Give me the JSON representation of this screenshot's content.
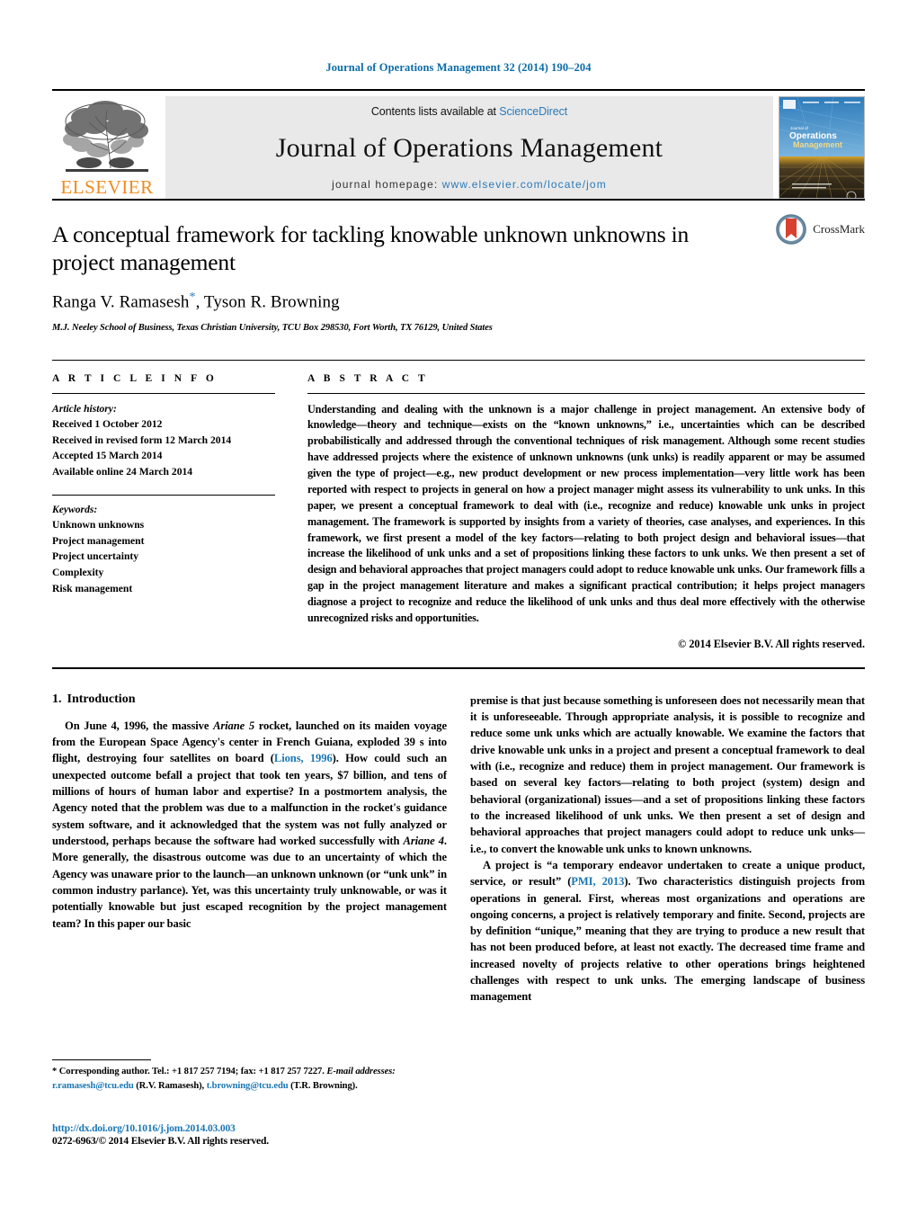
{
  "running_head": "Journal of Operations Management 32 (2014) 190–204",
  "masthead": {
    "contents_prefix": "Contents lists available at ",
    "sciencedirect": "ScienceDirect",
    "journal_name": "Journal of Operations Management",
    "homepage_label": "journal homepage:",
    "homepage_url": "www.elsevier.com/locate/jom",
    "publisher": "ELSEVIER",
    "cover_line1": "Journal of",
    "cover_line2": "Operations",
    "cover_line3": "Management",
    "link_color": "#2a7ab9",
    "publisher_color": "#ee8b1e"
  },
  "article": {
    "title": "A conceptual framework for tackling knowable unknown unknowns in project management",
    "authors": "Ranga V. Ramasesh",
    "authors_rest": ", Tyson R. Browning",
    "corresponding_marker": "*",
    "affiliation": "M.J. Neeley School of Business, Texas Christian University, TCU Box 298530, Fort Worth, TX 76129, United States",
    "crossmark_label": "CrossMark"
  },
  "info": {
    "heading": "A R T I C L E   I N F O",
    "history_label": "Article history:",
    "history": [
      "Received 1 October 2012",
      "Received in revised form 12 March 2014",
      "Accepted 15 March 2014",
      "Available online 24 March 2014"
    ],
    "keywords_label": "Keywords:",
    "keywords": [
      "Unknown unknowns",
      "Project management",
      "Project uncertainty",
      "Complexity",
      "Risk management"
    ]
  },
  "abstract": {
    "heading": "A B S T R A C T",
    "text": "Understanding and dealing with the unknown is a major challenge in project management. An extensive body of knowledge—theory and technique—exists on the “known unknowns,” i.e., uncertainties which can be described probabilistically and addressed through the conventional techniques of risk management. Although some recent studies have addressed projects where the existence of unknown unknowns (unk unks) is readily apparent or may be assumed given the type of project—e.g., new product development or new process implementation—very little work has been reported with respect to projects in general on how a project manager might assess its vulnerability to unk unks. In this paper, we present a conceptual framework to deal with (i.e., recognize and reduce) knowable unk unks in project management. The framework is supported by insights from a variety of theories, case analyses, and experiences. In this framework, we first present a model of the key factors—relating to both project design and behavioral issues—that increase the likelihood of unk unks and a set of propositions linking these factors to unk unks. We then present a set of design and behavioral approaches that project managers could adopt to reduce knowable unk unks. Our framework fills a gap in the project management literature and makes a significant practical contribution; it helps project managers diagnose a project to recognize and reduce the likelihood of unk unks and thus deal more effectively with the otherwise unrecognized risks and opportunities.",
    "copyright": "© 2014 Elsevier B.V. All rights reserved."
  },
  "body": {
    "section_number": "1.",
    "section_title": "Introduction",
    "left_p1_a": "On June 4, 1996, the massive ",
    "left_p1_italic1": "Ariane 5",
    "left_p1_b": " rocket, launched on its maiden voyage from the European Space Agency's center in French Guiana, exploded 39 s into flight, destroying four satellites on board (",
    "left_p1_cite": "Lions, 1996",
    "left_p1_c": "). How could such an unexpected outcome befall a project that took ten years, $7 billion, and tens of millions of hours of human labor and expertise? In a postmortem analysis, the Agency noted that the problem was due to a malfunction in the rocket's guidance system software, and it acknowledged that the system was not fully analyzed or understood, perhaps because the software had worked successfully with ",
    "left_p1_italic2": "Ariane 4",
    "left_p1_d": ". More generally, the disastrous outcome was due to an uncertainty of which the Agency was unaware prior to the launch—an unknown unknown (or “unk unk” in common industry parlance). Yet, was this uncertainty truly unknowable, or was it potentially knowable but just escaped recognition by the project management team? In this paper our basic",
    "right_p1": "premise is that just because something is unforeseen does not necessarily mean that it is unforeseeable. Through appropriate analysis, it is possible to recognize and reduce some unk unks which are actually knowable. We examine the factors that drive knowable unk unks in a project and present a conceptual framework to deal with (i.e., recognize and reduce) them in project management. Our framework is based on several key factors—relating to both project (system) design and behavioral (organizational) issues—and a set of propositions linking these factors to the increased likelihood of unk unks. We then present a set of design and behavioral approaches that project managers could adopt to reduce unk unks—i.e., to convert the knowable unk unks to known unknowns.",
    "right_p2_a": "A project is “a temporary endeavor undertaken to create a unique product, service, or result” (",
    "right_p2_cite": "PMI, 2013",
    "right_p2_b": "). Two characteristics distinguish projects from operations in general. First, whereas most organizations and operations are ongoing concerns, a project is relatively temporary and finite. Second, projects are by definition “unique,” meaning that they are trying to produce a new result that has not been produced before, at least not exactly. The decreased time frame and increased novelty of projects relative to other operations brings heightened challenges with respect to unk unks. The emerging landscape of business management"
  },
  "footnote": {
    "corresponding": "* Corresponding author. Tel.: +1 817 257 7194; fax: +1 817 257 7227.",
    "email_label": "E-mail addresses:",
    "email1": "r.ramasesh@tcu.edu",
    "email1_name": "(R.V. Ramasesh),",
    "email2": "t.browning@tcu.edu",
    "email2_name": "(T.R. Browning)."
  },
  "publication": {
    "doi": "http://dx.doi.org/10.1016/j.jom.2014.03.003",
    "issn": "0272-6963/© 2014 Elsevier B.V. All rights reserved."
  }
}
